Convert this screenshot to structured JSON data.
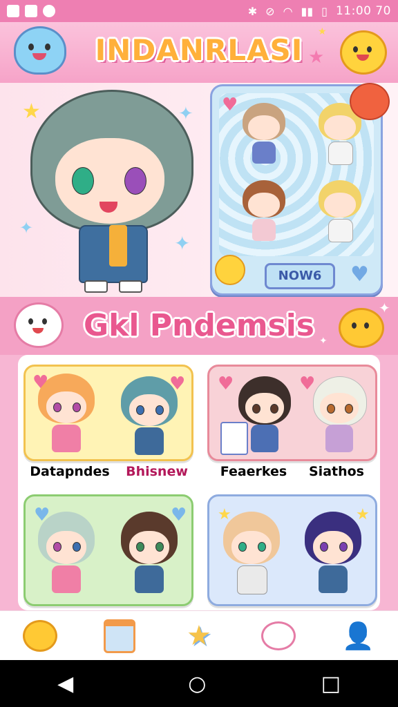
{
  "status_bar": {
    "time": "11:00 70"
  },
  "header": {
    "title": "INDANRLASI"
  },
  "preview": {
    "button_label": "NOW6"
  },
  "section": {
    "title": "Gkl Pndemsis"
  },
  "cards": [
    {
      "label": "Datapndes",
      "color": "#fff3b5",
      "border": "#f2c24f",
      "label_color": "#2b2b2b"
    },
    {
      "label": "Bhisnew",
      "color": "#f8d2d7",
      "border": "#e88a9a",
      "label_color": "#b3185a"
    },
    {
      "label": "Feaerkes",
      "color": "#d8f1c8",
      "border": "#8ccc71",
      "label_color": "#2b2b2b"
    },
    {
      "label": "Siathos",
      "color": "#dbe8fb",
      "border": "#8eabdf",
      "label_color": "#2b2b2b"
    }
  ],
  "nav": {
    "items": [
      {
        "icon": "sun-mascot-icon"
      },
      {
        "icon": "calendar-icon"
      },
      {
        "icon": "star-icon"
      },
      {
        "icon": "bunny-icon"
      },
      {
        "icon": "profile-icon"
      }
    ]
  },
  "system_nav": {
    "back": "◀",
    "home": "○",
    "recents": "□"
  }
}
